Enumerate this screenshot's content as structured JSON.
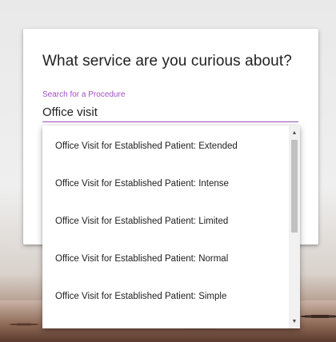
{
  "dialog": {
    "title": "What service are you curious about?",
    "search": {
      "label": "Search for a Procedure",
      "value": "Office visit",
      "accent_color": "#a14fc7"
    }
  },
  "dropdown": {
    "options": [
      "Office Visit for Established Patient: Extended",
      "Office Visit for Established Patient: Intense",
      "Office Visit for Established Patient: Limited",
      "Office Visit for Established Patient: Normal",
      "Office Visit for Established Patient: Simple"
    ],
    "scrollbar": {
      "up_icon": "scroll-up-arrow-icon",
      "down_icon": "scroll-down-arrow-icon"
    }
  }
}
